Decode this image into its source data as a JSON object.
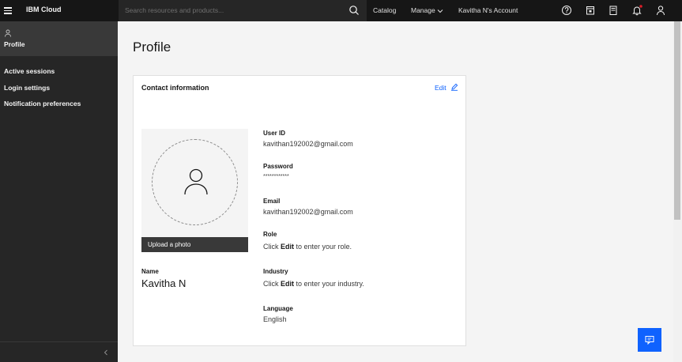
{
  "header": {
    "brand": "IBM Cloud",
    "search_placeholder": "Search resources and products...",
    "nav_catalog": "Catalog",
    "nav_manage": "Manage",
    "nav_account": "Kavitha N's Account"
  },
  "sidebar": {
    "active": "Profile",
    "items": [
      {
        "label": "Active sessions"
      },
      {
        "label": "Login settings"
      },
      {
        "label": "Notification preferences"
      }
    ]
  },
  "main": {
    "title": "Profile",
    "card": {
      "title": "Contact information",
      "edit_label": "Edit",
      "upload_label": "Upload a photo",
      "name_label": "Name",
      "name_value": "Kavitha N",
      "fields": [
        {
          "label": "User ID",
          "value": "kavithan192002@gmail.com"
        },
        {
          "label": "Password",
          "value": "************"
        },
        {
          "label": "Email",
          "value": "kavithan192002@gmail.com"
        },
        {
          "label": "Role",
          "pre": "Click ",
          "bold": "Edit",
          "post": " to enter your role."
        },
        {
          "label": "Industry",
          "pre": "Click ",
          "bold": "Edit",
          "post": " to enter your industry."
        },
        {
          "label": "Language",
          "value": "English"
        }
      ]
    }
  },
  "colors": {
    "accent": "#0f62fe",
    "notification_dot": "#da1e28"
  }
}
